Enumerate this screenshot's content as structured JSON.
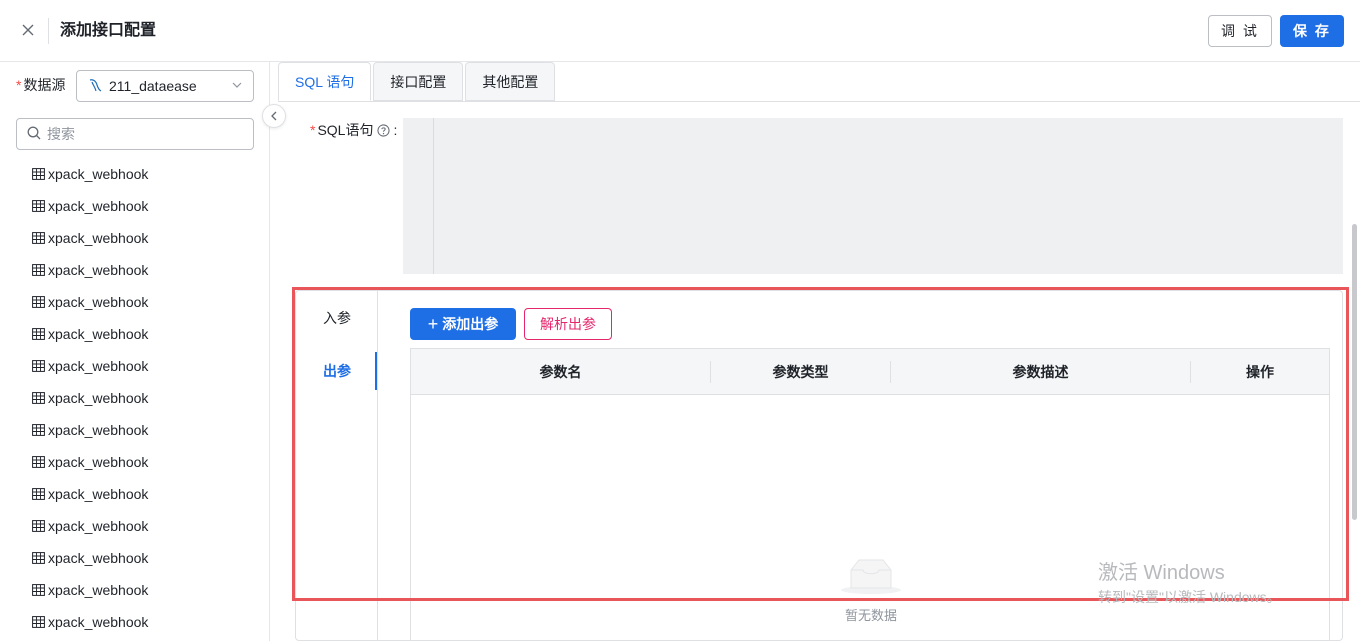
{
  "header": {
    "title": "添加接口配置",
    "debug_label": "调 试",
    "save_label": "保 存"
  },
  "left": {
    "datasource_label": "数据源",
    "datasource_value": "211_dataease",
    "search_placeholder": "搜索",
    "tables": [
      "xpack_webhook",
      "xpack_webhook",
      "xpack_webhook",
      "xpack_webhook",
      "xpack_webhook",
      "xpack_webhook",
      "xpack_webhook",
      "xpack_webhook",
      "xpack_webhook",
      "xpack_webhook",
      "xpack_webhook",
      "xpack_webhook",
      "xpack_webhook",
      "xpack_webhook",
      "xpack_webhook"
    ]
  },
  "tabs": [
    "SQL 语句",
    "接口配置",
    "其他配置"
  ],
  "sql": {
    "label": "SQL语句",
    "colon": ":"
  },
  "params": {
    "side_tabs": [
      "入参",
      "出参"
    ],
    "add_label": "添加出参",
    "parse_label": "解析出参",
    "columns": [
      "参数名",
      "参数类型",
      "参数描述",
      "操作"
    ],
    "empty_text": "暂无数据"
  },
  "watermark": {
    "title": "激活 Windows",
    "subtitle": "转到\"设置\"以激活 Windows。"
  },
  "colors": {
    "primary": "#1e6ee6",
    "danger_outline": "#e6266c",
    "highlight": "#e8565a"
  }
}
